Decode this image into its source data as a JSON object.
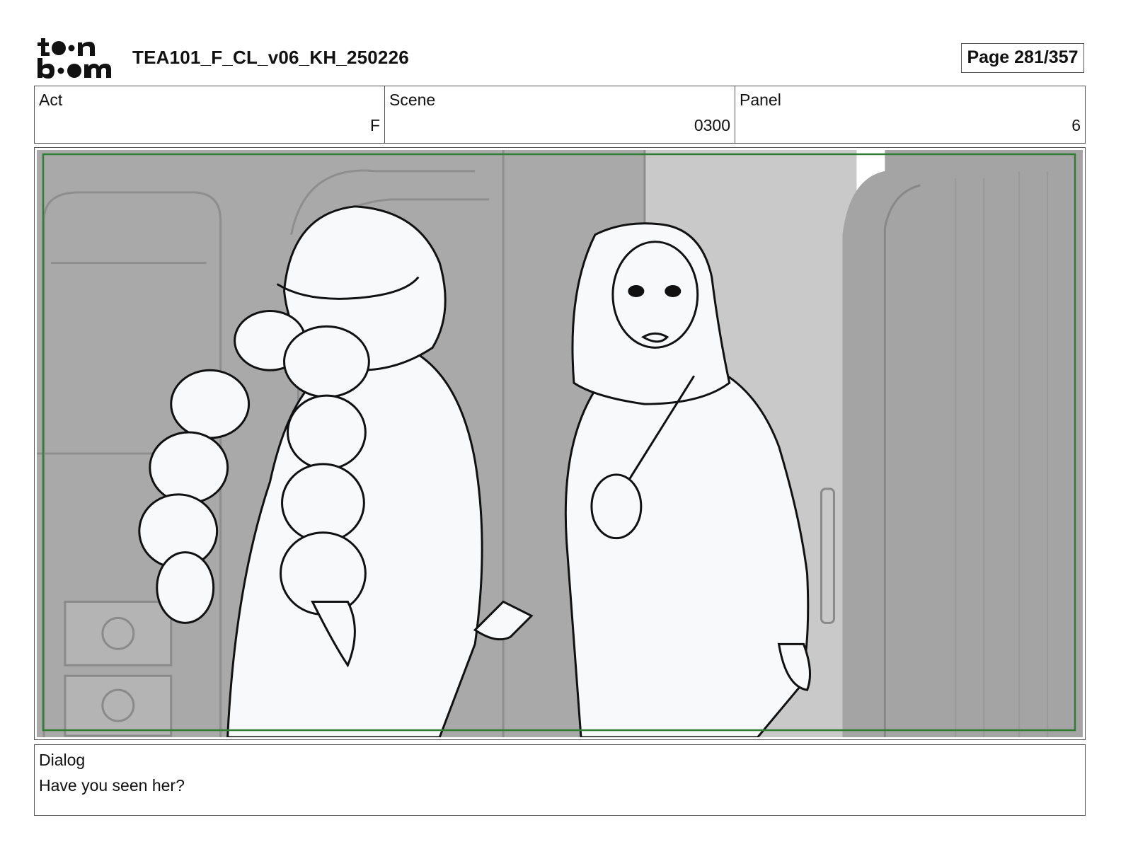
{
  "header": {
    "logo_text": "toonboom",
    "document_title": "TEA101_F_CL_v06_KH_250226",
    "page_indicator": "Page 281/357"
  },
  "info": {
    "act": {
      "label": "Act",
      "value": "F"
    },
    "scene": {
      "label": "Scene",
      "value": "0300"
    },
    "panel": {
      "label": "Panel",
      "value": "6"
    }
  },
  "dialog": {
    "label": "Dialog",
    "text": "Have you seen her?"
  },
  "colors": {
    "safe_frame": "#2e7d32",
    "background_gray": "#a8a8a8",
    "figure_fill": "#f7f8fa"
  }
}
